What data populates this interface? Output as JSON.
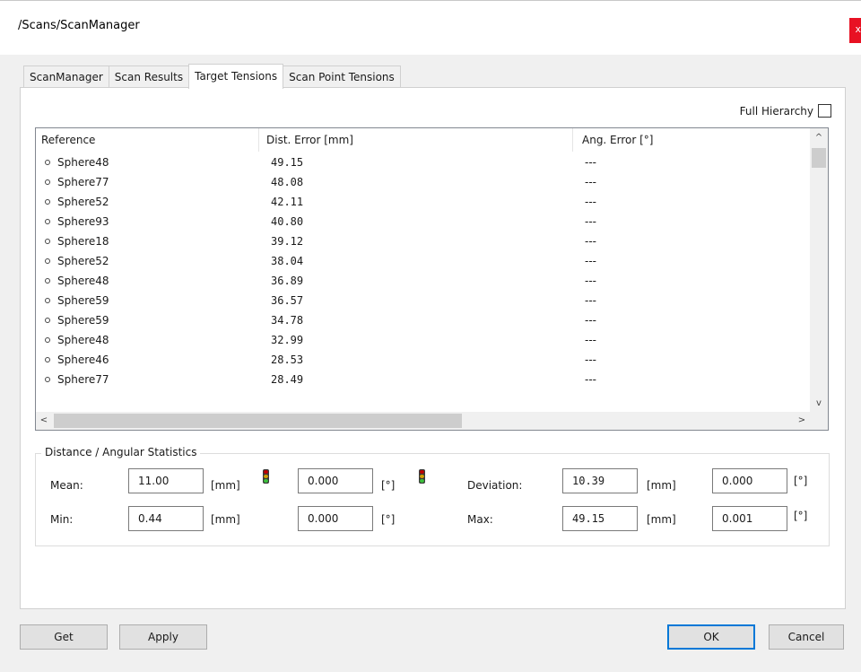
{
  "window": {
    "title": "/Scans/ScanManager",
    "close_glyph": "x"
  },
  "tabs": [
    {
      "label": "ScanManager"
    },
    {
      "label": "Scan Results"
    },
    {
      "label": "Target Tensions"
    },
    {
      "label": "Scan Point Tensions"
    }
  ],
  "active_tab": 2,
  "full_hierarchy": {
    "label": "Full Hierarchy",
    "checked": false
  },
  "list": {
    "columns": [
      "Reference",
      "Dist. Error [mm]",
      "Ang. Error [°]"
    ],
    "rows": [
      {
        "reference": "Sphere48",
        "dist": "49.15",
        "ang": "---"
      },
      {
        "reference": "Sphere77",
        "dist": "48.08",
        "ang": "---"
      },
      {
        "reference": "Sphere52",
        "dist": "42.11",
        "ang": "---"
      },
      {
        "reference": "Sphere93",
        "dist": "40.80",
        "ang": "---"
      },
      {
        "reference": "Sphere18",
        "dist": "39.12",
        "ang": "---"
      },
      {
        "reference": "Sphere52",
        "dist": "38.04",
        "ang": "---"
      },
      {
        "reference": "Sphere48",
        "dist": "36.89",
        "ang": "---"
      },
      {
        "reference": "Sphere59",
        "dist": "36.57",
        "ang": "---"
      },
      {
        "reference": "Sphere59",
        "dist": "34.78",
        "ang": "---"
      },
      {
        "reference": "Sphere48",
        "dist": "32.99",
        "ang": "---"
      },
      {
        "reference": "Sphere46",
        "dist": "28.53",
        "ang": "---"
      },
      {
        "reference": "Sphere77",
        "dist": "28.49",
        "ang": "---"
      }
    ],
    "row_icon": "sphere-icon",
    "scroll_up": "^",
    "scroll_down": "v",
    "scroll_left": "<",
    "scroll_right": ">"
  },
  "stats": {
    "title": "Distance / Angular Statistics",
    "mean_label": "Mean:",
    "mean_value": "11.00",
    "mean_ang_value": "0.000",
    "min_label": "Min:",
    "min_value": "0.44",
    "min_ang_value": "0.000",
    "deviation_label": "Deviation:",
    "deviation_value": "10.39",
    "deviation_ang_value": "0.000",
    "max_label": "Max:",
    "max_value": "49.15",
    "max_ang_value": "0.001",
    "unit_mm": "[mm]",
    "unit_deg": "[°]",
    "indicator_icon": "traffic-light-icon",
    "indicator_colors": {
      "top": "#c00000",
      "middle": "#d4a000",
      "bottom": "#3cc23c"
    }
  },
  "buttons": {
    "get": "Get",
    "apply": "Apply",
    "ok": "OK",
    "cancel": "Cancel"
  }
}
